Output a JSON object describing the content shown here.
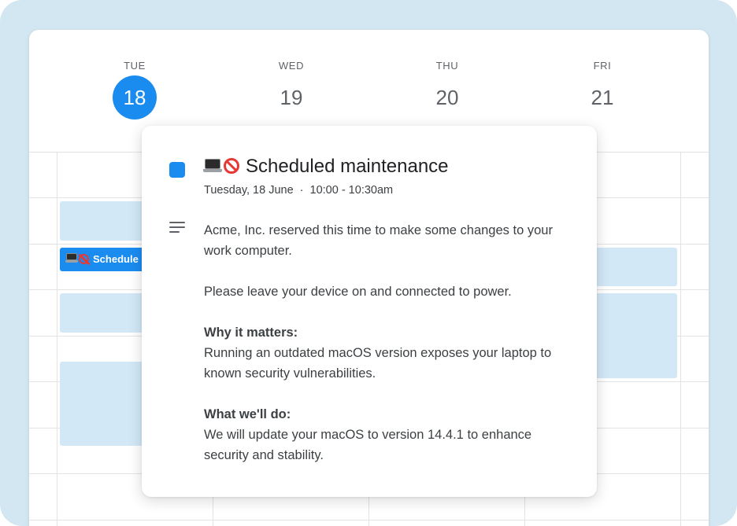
{
  "days": [
    {
      "dow": "TUE",
      "num": "18",
      "today": true
    },
    {
      "dow": "WED",
      "num": "19",
      "today": false
    },
    {
      "dow": "THU",
      "num": "20",
      "today": false
    },
    {
      "dow": "FRI",
      "num": "21",
      "today": false
    }
  ],
  "calendar_event_chip": {
    "label": "Schedule"
  },
  "popup": {
    "title": "Scheduled maintenance",
    "date": "Tuesday, 18 June",
    "separator": "·",
    "time": "10:00 - 10:30am",
    "description": {
      "intro": "Acme, Inc. reserved this time to make some changes to your work computer.",
      "request": "Please leave your device on and connected to power.",
      "why_heading": "Why it matters:",
      "why_text": "Running an outdated macOS version exposes your laptop to known security vulnerabilities.",
      "what_heading": "What we'll do:",
      "what_text": "We will update your macOS to version 14.4.1 to enhance security and stability."
    },
    "icons": {
      "color": "color-square-icon",
      "description": "description-lines-icon",
      "emoji": [
        "laptop-icon",
        "no-entry-icon"
      ]
    }
  },
  "colors": {
    "accent": "#1a8cf0",
    "event_light": "#d2e8f7",
    "frame": "#d3e7f2"
  }
}
